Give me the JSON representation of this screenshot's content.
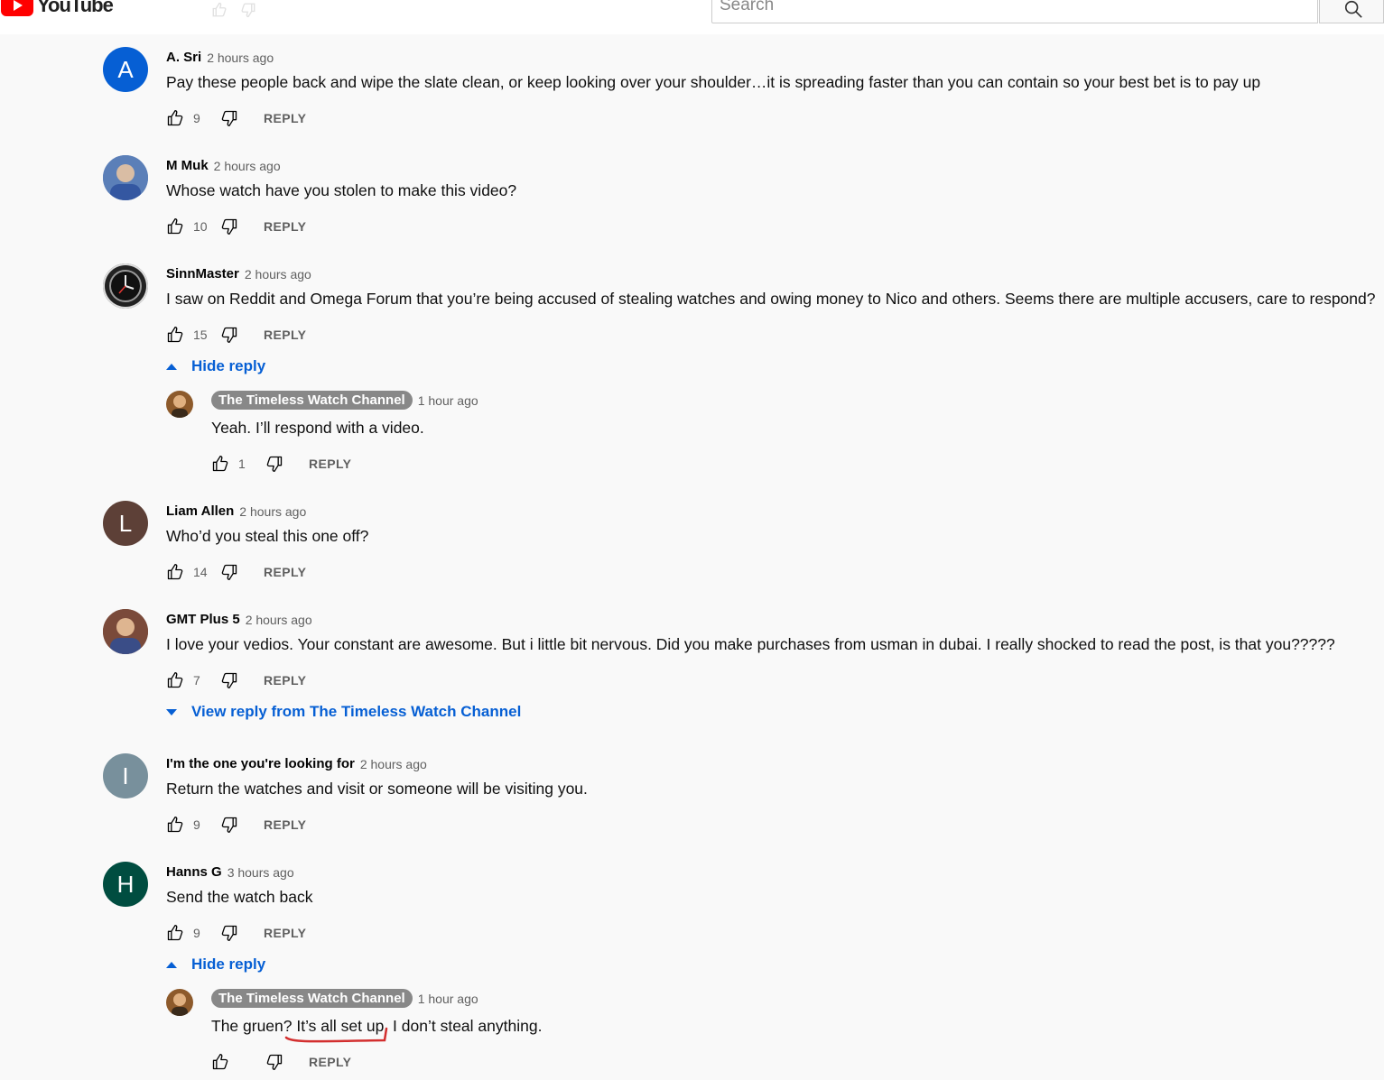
{
  "header": {
    "logo_text": "YouTube",
    "search_placeholder": "Search"
  },
  "comments": [
    {
      "author": "A. Sri",
      "time": "2 hours ago",
      "text": "Pay these people back and wipe the slate clean, or keep looking over your shoulder…it is spreading faster than you can contain so your best bet is to pay up",
      "likes": "9",
      "avatar_letter": "A",
      "avatar_color": "#065fd4"
    },
    {
      "author": "M Muk",
      "time": "2 hours ago",
      "text": "Whose watch have you stolen to make this video?",
      "likes": "10",
      "avatar_letter": "",
      "avatar_color": "#5b7fb8"
    },
    {
      "author": "SinnMaster",
      "time": "2 hours ago",
      "text": "I saw on Reddit and Omega Forum that you’re being accused of stealing watches and owing money to Nico and others.  Seems there are multiple accusers, care to respond?",
      "likes": "15",
      "avatar_letter": "",
      "avatar_color": "#333333",
      "toggle": "Hide reply",
      "reply": {
        "author": "The Timeless Watch Channel",
        "time": "1 hour ago",
        "text": "Yeah. I’ll respond with a video.",
        "likes": "1"
      }
    },
    {
      "author": "Liam Allen",
      "time": "2 hours ago",
      "text": "Who’d you steal this one off?",
      "likes": "14",
      "avatar_letter": "L",
      "avatar_color": "#5d4037"
    },
    {
      "author": "GMT Plus 5",
      "time": "2 hours ago",
      "text": "I love your vedios. Your constant are awesome. But i little bit nervous. Did you make purchases from usman in dubai. I really shocked to read the post,  is that you?????",
      "likes": "7",
      "avatar_letter": "",
      "avatar_color": "#7a4a3a",
      "toggle": "View reply from The Timeless Watch Channel"
    },
    {
      "author": "I'm the one you're looking for",
      "time": "2 hours ago",
      "text": "Return the watches and visit or someone will be visiting you.",
      "likes": "9",
      "avatar_letter": "I",
      "avatar_color": "#78909c"
    },
    {
      "author": "Hanns G",
      "time": "3 hours ago",
      "text": "Send the watch back",
      "likes": "9",
      "avatar_letter": "H",
      "avatar_color": "#004d40",
      "toggle": "Hide reply",
      "reply": {
        "author": "The Timeless Watch Channel",
        "time": "1 hour ago",
        "text": "The gruen? It’s all set up. I don’t steal anything.",
        "likes": ""
      }
    }
  ],
  "labels": {
    "reply": "REPLY"
  },
  "colors": {
    "link": "#065fd4",
    "annotation": "#d32f2f"
  }
}
